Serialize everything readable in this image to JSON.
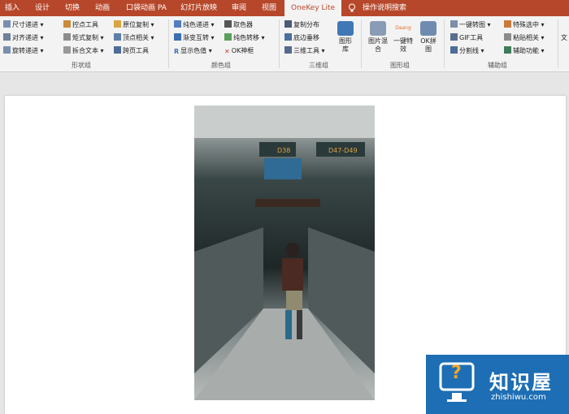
{
  "tabs": [
    {
      "label": "插入"
    },
    {
      "label": "设计"
    },
    {
      "label": "切换"
    },
    {
      "label": "动画"
    },
    {
      "label": "口袋动画 PA"
    },
    {
      "label": "幻灯片放映"
    },
    {
      "label": "审阅"
    },
    {
      "label": "视图"
    },
    {
      "label": "OneKey Lite"
    },
    {
      "label": "操作说明搜索"
    }
  ],
  "groups": {
    "shape": {
      "label": "形状组",
      "items": [
        "尺寸递进",
        "控点工具",
        "原位复制",
        "对齐递进",
        "矩式复制",
        "顶点相关",
        "旋转递进",
        "拆合文本",
        "跨页工具"
      ]
    },
    "color": {
      "label": "颜色组",
      "items": [
        "纯色递进",
        "取色器",
        "渐变互转",
        "纯色转移",
        "显示色值",
        "OK神框"
      ]
    },
    "threed": {
      "label": "三维组",
      "items": [
        "复制分布",
        "底边垂移",
        "三维工具"
      ],
      "big": {
        "line1": "图形",
        "line2": "库"
      }
    },
    "graphic": {
      "label": "图形组",
      "big": [
        {
          "line1": "图片混",
          "line2": "合"
        },
        {
          "line1": "一键特",
          "line2": "效",
          "badge": "Daang"
        },
        {
          "line1": "OK拼",
          "line2": "图"
        }
      ]
    },
    "aux": {
      "label": "辅助组",
      "items": [
        "一键转图",
        "特殊选中",
        "GIF工具",
        "粘贴相关",
        "分割线",
        "辅助功能"
      ],
      "cut": "文"
    }
  },
  "photo_text": {
    "gate1": "D38",
    "gate2": "D47-D49"
  },
  "watermark": {
    "title": "知识屋",
    "url": "zhishiwu.com",
    "glyph": "?"
  },
  "colors": {
    "tabbar": "#b7472a",
    "ribbon": "#f3f3f3",
    "watermark": "#1d6eb4"
  }
}
